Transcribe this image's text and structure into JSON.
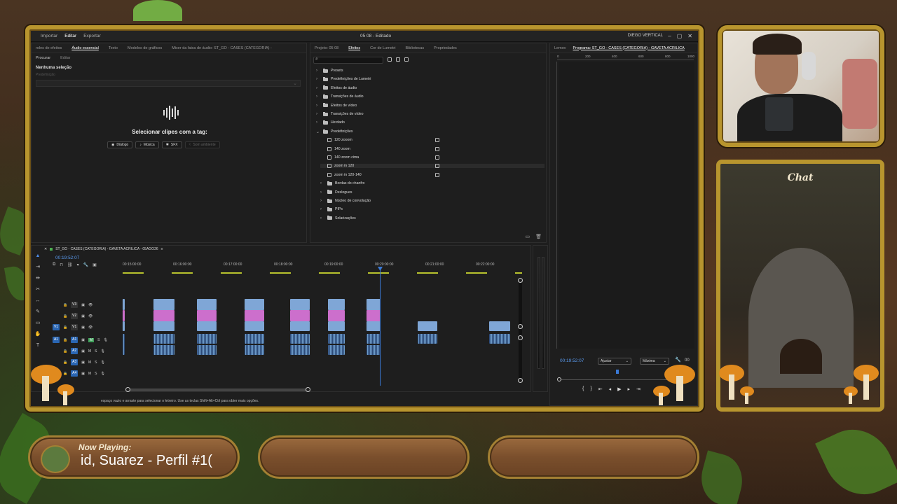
{
  "app": {
    "menu": [
      "Importar",
      "Editar",
      "Exportar"
    ],
    "menu_active": "Editar",
    "doc_title": "05 08 - Editado",
    "user": "DIEGO VERTICAL"
  },
  "essential_audio": {
    "tabs": [
      "roles de efeitos",
      "Áudio essencial",
      "Texto",
      "Modelos de gráficos",
      "Mixer da faixa de áudio: ST_GO - CASES (CATEGORIA) -"
    ],
    "active_tab": "Áudio essencial",
    "subtabs": [
      "Procurar",
      "Editar"
    ],
    "no_selection": "Nenhuma seleção",
    "preset_placeholder": "Predefinição",
    "select_prompt": "Selecionar clipes com a tag:",
    "tags": [
      {
        "label": "Diálogo",
        "icon": "speech-icon"
      },
      {
        "label": "Música",
        "icon": "music-note-icon"
      },
      {
        "label": "SFX",
        "icon": "sfx-icon"
      },
      {
        "label": "Som ambiente",
        "icon": "ambience-icon"
      }
    ]
  },
  "effects": {
    "tabs": [
      "Projeto: 05 08",
      "Efeitos",
      "Cor de Lumetri",
      "Bibliotecas",
      "Propriedades"
    ],
    "active_tab": "Efeitos",
    "items": [
      {
        "label": "Presets",
        "type": "folder",
        "indent": 0,
        "open": false
      },
      {
        "label": "Predefinições de Lumetri",
        "type": "folder",
        "indent": 0,
        "open": false
      },
      {
        "label": "Efeitos de áudio",
        "type": "folder",
        "indent": 0,
        "open": false
      },
      {
        "label": "Transições de áudio",
        "type": "folder",
        "indent": 0,
        "open": false
      },
      {
        "label": "Efeitos de vídeo",
        "type": "folder",
        "indent": 0,
        "open": false
      },
      {
        "label": "Transições de vídeo",
        "type": "folder",
        "indent": 0,
        "open": false
      },
      {
        "label": "Herdado",
        "type": "folder",
        "indent": 0,
        "open": false
      },
      {
        "label": "Predefinições",
        "type": "folder",
        "indent": 0,
        "open": true
      },
      {
        "label": "120 zooom",
        "type": "preset",
        "indent": 1
      },
      {
        "label": "140 zoom",
        "type": "preset",
        "indent": 1
      },
      {
        "label": "140 zoom cima",
        "type": "preset",
        "indent": 1
      },
      {
        "label": "zoom in 120",
        "type": "preset",
        "indent": 1,
        "selected": true
      },
      {
        "label": "zoom in 120-140",
        "type": "preset",
        "indent": 1
      },
      {
        "label": "Bordas do chanfro",
        "type": "folder",
        "indent": 1
      },
      {
        "label": "Deslogues",
        "type": "folder",
        "indent": 1
      },
      {
        "label": "Núcleo de convolução",
        "type": "folder",
        "indent": 1
      },
      {
        "label": "PIPs",
        "type": "folder",
        "indent": 1
      },
      {
        "label": "Solarizações",
        "type": "folder",
        "indent": 1
      }
    ]
  },
  "program": {
    "tabs": [
      "Lemov",
      "Programa: ST_GO - CASES (CATEGORIA) - GAVETA ACRILICA"
    ],
    "ruler": [
      "0",
      "200",
      "400",
      "600",
      "800",
      "1000"
    ],
    "timecode": "00:19:52:07",
    "fit": "Ajustar",
    "quality": "Máxima",
    "end_timecode": "00"
  },
  "timeline": {
    "title": "ST_GO - CASES (CATEGORIA) - GAVETA ACRILICA - 05AGO26",
    "timecode": "00:19:52:07",
    "ruler": [
      "00:15:00:00",
      "00:16:00:00",
      "00:17:00:00",
      "00:18:00:00",
      "00:19:00:00",
      "00:20:00:00",
      "00:21:00:00",
      "00:22:00:00"
    ],
    "tracks": [
      {
        "id": "V3",
        "kind": "video"
      },
      {
        "id": "V2",
        "kind": "video"
      },
      {
        "id": "V1",
        "kind": "video"
      },
      {
        "id": "A1",
        "kind": "audio"
      },
      {
        "id": "A2",
        "kind": "audio"
      },
      {
        "id": "A3",
        "kind": "audio"
      },
      {
        "id": "A4",
        "kind": "audio"
      }
    ],
    "source_v": "V1",
    "source_a": "A1",
    "track_letters": {
      "mute": "M",
      "solo": "S"
    },
    "status": "espaço vazio e arraste para selecionar o letreiro. Use as teclas Shift+Alt+Ctrl para obter mais opções."
  },
  "overlay": {
    "chat_title": "Chat",
    "now_playing_label": "Now Playing:",
    "now_playing_track": "id, Suarez - Perfil #1("
  },
  "colors": {
    "accent_gold": "#b8952e",
    "clip_video": "#7fa6d6",
    "clip_pink": "#cc6fcc",
    "clip_audio": "#6c9ac8",
    "track_blue": "#2a66b3"
  }
}
